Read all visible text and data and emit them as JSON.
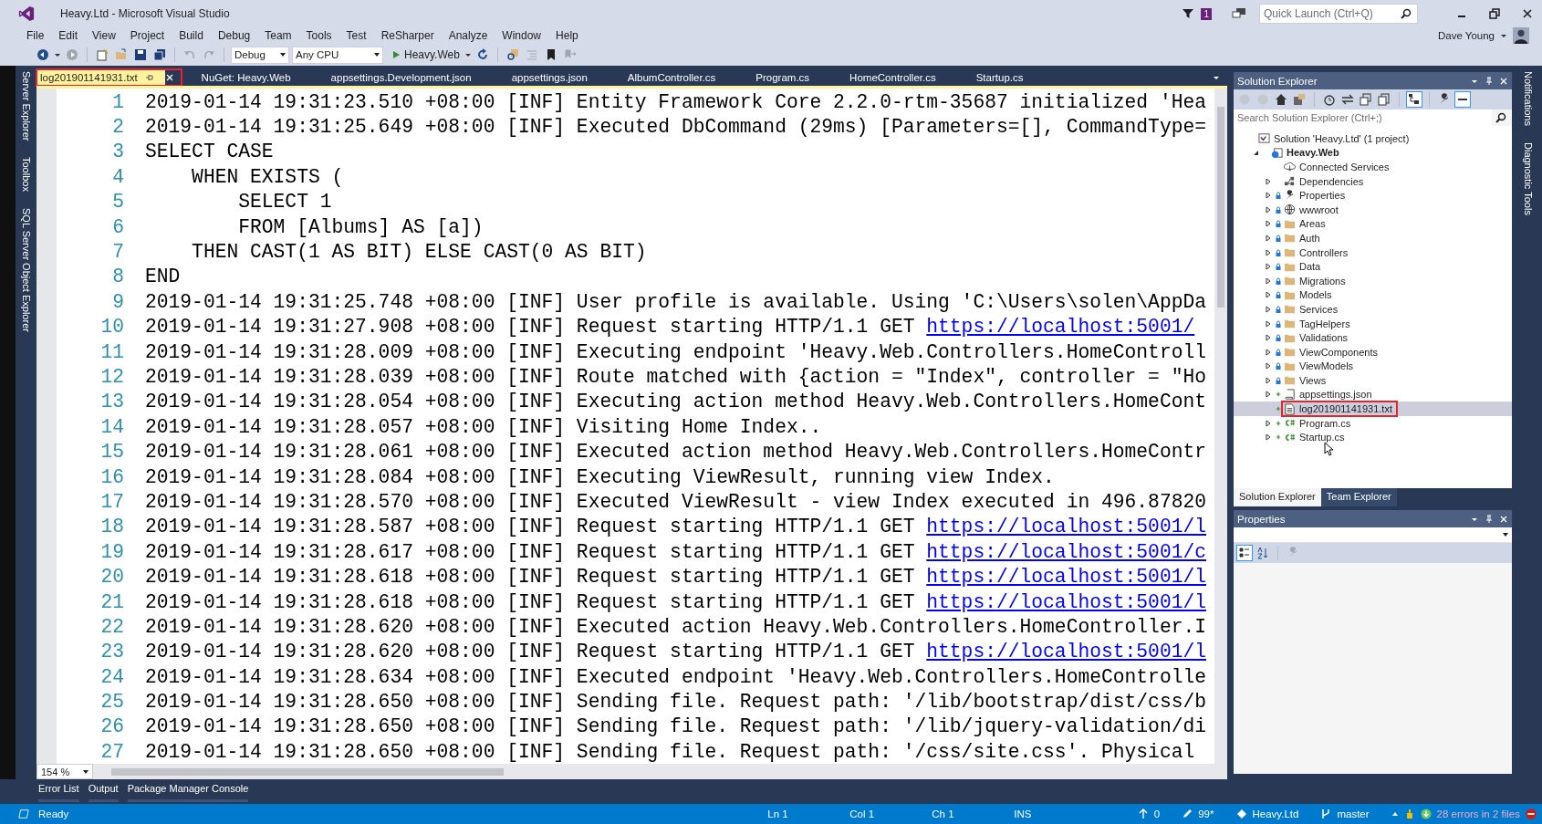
{
  "window": {
    "title": "Heavy.Ltd - Microsoft Visual Studio",
    "notification_count": "1",
    "quick_launch": {
      "placeholder": "Quick Launch (Ctrl+Q)"
    },
    "user": "Dave Young"
  },
  "menu": [
    "File",
    "Edit",
    "View",
    "Project",
    "Build",
    "Debug",
    "Team",
    "Tools",
    "Test",
    "ReSharper",
    "Analyze",
    "Window",
    "Help"
  ],
  "toolbar": {
    "configuration": "Debug",
    "platform": "Any CPU",
    "start_project": "Heavy.Web"
  },
  "left_tool_tabs": [
    "Server Explorer",
    "Toolbox",
    "SQL Server Object Explorer"
  ],
  "tabs": [
    {
      "label": "log201901141931.txt",
      "selected": true,
      "pinned": true,
      "marked": true
    },
    {
      "label": "NuGet: Heavy.Web",
      "selected": false,
      "pinned": false,
      "marked": false
    },
    {
      "label": "appsettings.Development.json",
      "selected": false,
      "pinned": false,
      "marked": false
    },
    {
      "label": "appsettings.json",
      "selected": false,
      "pinned": false,
      "marked": false
    },
    {
      "label": "AlbumController.cs",
      "selected": false,
      "pinned": false,
      "marked": false
    },
    {
      "label": "Program.cs",
      "selected": false,
      "pinned": false,
      "marked": false
    },
    {
      "label": "HomeController.cs",
      "selected": false,
      "pinned": false,
      "marked": false
    },
    {
      "label": "Startup.cs",
      "selected": false,
      "pinned": false,
      "marked": false
    }
  ],
  "editor": {
    "zoom": "154 %",
    "lines": [
      {
        "number": "1",
        "text": "2019-01-14 19:31:23.510 +08:00 [INF] Entity Framework Core 2.2.0-rtm-35687 initialized 'Hea"
      },
      {
        "number": "2",
        "text": "2019-01-14 19:31:25.649 +08:00 [INF] Executed DbCommand (29ms) [Parameters=[], CommandType="
      },
      {
        "number": "3",
        "text": "SELECT CASE"
      },
      {
        "number": "4",
        "text": "    WHEN EXISTS ("
      },
      {
        "number": "5",
        "text": "        SELECT 1"
      },
      {
        "number": "6",
        "text": "        FROM [Albums] AS [a])"
      },
      {
        "number": "7",
        "text": "    THEN CAST(1 AS BIT) ELSE CAST(0 AS BIT)"
      },
      {
        "number": "8",
        "text": "END"
      },
      {
        "number": "9",
        "text": "2019-01-14 19:31:25.748 +08:00 [INF] User profile is available. Using 'C:\\Users\\solen\\AppDa"
      },
      {
        "number": "10",
        "text": "2019-01-14 19:31:27.908 +08:00 [INF] Request starting HTTP/1.1 GET ",
        "link": "https://localhost:5001/"
      },
      {
        "number": "11",
        "text": "2019-01-14 19:31:28.009 +08:00 [INF] Executing endpoint 'Heavy.Web.Controllers.HomeControll"
      },
      {
        "number": "12",
        "text": "2019-01-14 19:31:28.039 +08:00 [INF] Route matched with {action = \"Index\", controller = \"Ho"
      },
      {
        "number": "13",
        "text": "2019-01-14 19:31:28.054 +08:00 [INF] Executing action method Heavy.Web.Controllers.HomeCont"
      },
      {
        "number": "14",
        "text": "2019-01-14 19:31:28.057 +08:00 [INF] Visiting Home Index.."
      },
      {
        "number": "15",
        "text": "2019-01-14 19:31:28.061 +08:00 [INF] Executed action method Heavy.Web.Controllers.HomeContr"
      },
      {
        "number": "16",
        "text": "2019-01-14 19:31:28.084 +08:00 [INF] Executing ViewResult, running view Index."
      },
      {
        "number": "17",
        "text": "2019-01-14 19:31:28.570 +08:00 [INF] Executed ViewResult - view Index executed in 496.87820"
      },
      {
        "number": "18",
        "text": "2019-01-14 19:31:28.587 +08:00 [INF] Request starting HTTP/1.1 GET ",
        "link": "https://localhost:5001/l"
      },
      {
        "number": "19",
        "text": "2019-01-14 19:31:28.617 +08:00 [INF] Request starting HTTP/1.1 GET ",
        "link": "https://localhost:5001/c"
      },
      {
        "number": "20",
        "text": "2019-01-14 19:31:28.618 +08:00 [INF] Request starting HTTP/1.1 GET ",
        "link": "https://localhost:5001/l"
      },
      {
        "number": "21",
        "text": "2019-01-14 19:31:28.618 +08:00 [INF] Request starting HTTP/1.1 GET ",
        "link": "https://localhost:5001/l"
      },
      {
        "number": "22",
        "text": "2019-01-14 19:31:28.620 +08:00 [INF] Executed action Heavy.Web.Controllers.HomeController.I"
      },
      {
        "number": "23",
        "text": "2019-01-14 19:31:28.620 +08:00 [INF] Request starting HTTP/1.1 GET ",
        "link": "https://localhost:5001/l"
      },
      {
        "number": "24",
        "text": "2019-01-14 19:31:28.634 +08:00 [INF] Executed endpoint 'Heavy.Web.Controllers.HomeControlle"
      },
      {
        "number": "25",
        "text": "2019-01-14 19:31:28.650 +08:00 [INF] Sending file. Request path: '/lib/bootstrap/dist/css/b"
      },
      {
        "number": "26",
        "text": "2019-01-14 19:31:28.650 +08:00 [INF] Sending file. Request path: '/lib/jquery-validation/di"
      },
      {
        "number": "27",
        "text": "2019-01-14 19:31:28.650 +08:00 [INF] Sending file. Request path: '/css/site.css'. Physical"
      }
    ]
  },
  "solution_explorer": {
    "title": "Solution Explorer",
    "search_placeholder": "Search Solution Explorer (Ctrl+;)",
    "tree": [
      {
        "label": "Solution 'Heavy.Ltd' (1 project)",
        "kind": "solution",
        "expandable": false,
        "locked": false,
        "added": false,
        "selected": false,
        "marked": false,
        "children": [
          {
            "label": "Heavy.Web",
            "kind": "project",
            "expandable": true,
            "expanded": true,
            "locked": false,
            "added": false,
            "selected": false,
            "marked": false,
            "children": [
              {
                "label": "Connected Services",
                "kind": "connected",
                "expandable": false,
                "locked": false,
                "added": false,
                "selected": false,
                "marked": false
              },
              {
                "label": "Dependencies",
                "kind": "dependencies",
                "expandable": true,
                "expanded": false,
                "locked": false,
                "added": false,
                "selected": false,
                "marked": false
              },
              {
                "label": "Properties",
                "kind": "properties",
                "expandable": true,
                "expanded": false,
                "locked": true,
                "added": false,
                "selected": false,
                "marked": false
              },
              {
                "label": "wwwroot",
                "kind": "webroot",
                "expandable": true,
                "expanded": false,
                "locked": true,
                "added": false,
                "selected": false,
                "marked": false
              },
              {
                "label": "Areas",
                "kind": "folder",
                "expandable": true,
                "expanded": false,
                "locked": true,
                "added": false,
                "selected": false,
                "marked": false
              },
              {
                "label": "Auth",
                "kind": "folder",
                "expandable": true,
                "expanded": false,
                "locked": true,
                "added": false,
                "selected": false,
                "marked": false
              },
              {
                "label": "Controllers",
                "kind": "folder",
                "expandable": true,
                "expanded": false,
                "locked": true,
                "added": false,
                "selected": false,
                "marked": false
              },
              {
                "label": "Data",
                "kind": "folder",
                "expandable": true,
                "expanded": false,
                "locked": true,
                "added": false,
                "selected": false,
                "marked": false
              },
              {
                "label": "Migrations",
                "kind": "folder",
                "expandable": true,
                "expanded": false,
                "locked": true,
                "added": false,
                "selected": false,
                "marked": false
              },
              {
                "label": "Models",
                "kind": "folder",
                "expandable": true,
                "expanded": false,
                "locked": true,
                "added": false,
                "selected": false,
                "marked": false
              },
              {
                "label": "Services",
                "kind": "folder",
                "expandable": true,
                "expanded": false,
                "locked": true,
                "added": false,
                "selected": false,
                "marked": false
              },
              {
                "label": "TagHelpers",
                "kind": "folder",
                "expandable": true,
                "expanded": false,
                "locked": true,
                "added": false,
                "selected": false,
                "marked": false
              },
              {
                "label": "Validations",
                "kind": "folder",
                "expandable": true,
                "expanded": false,
                "locked": true,
                "added": false,
                "selected": false,
                "marked": false
              },
              {
                "label": "ViewComponents",
                "kind": "folder",
                "expandable": true,
                "expanded": false,
                "locked": true,
                "added": false,
                "selected": false,
                "marked": false
              },
              {
                "label": "ViewModels",
                "kind": "folder",
                "expandable": true,
                "expanded": false,
                "locked": true,
                "added": false,
                "selected": false,
                "marked": false
              },
              {
                "label": "Views",
                "kind": "folder",
                "expandable": true,
                "expanded": false,
                "locked": true,
                "added": false,
                "selected": false,
                "marked": false
              },
              {
                "label": "appsettings.json",
                "kind": "json",
                "expandable": true,
                "expanded": false,
                "locked": false,
                "added": true,
                "selected": false,
                "marked": false
              },
              {
                "label": "log201901141931.txt",
                "kind": "text",
                "expandable": false,
                "locked": false,
                "added": true,
                "selected": true,
                "marked": true
              },
              {
                "label": "Program.cs",
                "kind": "csharp",
                "expandable": true,
                "expanded": false,
                "locked": false,
                "added": true,
                "selected": false,
                "marked": false
              },
              {
                "label": "Startup.cs",
                "kind": "csharp",
                "expandable": true,
                "expanded": false,
                "locked": false,
                "added": true,
                "selected": false,
                "marked": false
              }
            ]
          }
        ]
      }
    ],
    "panel_tabs": [
      {
        "label": "Solution Explorer",
        "selected": true
      },
      {
        "label": "Team Explorer",
        "selected": false
      }
    ]
  },
  "properties": {
    "title": "Properties"
  },
  "right_tool_tabs": [
    "Notifications",
    "Diagnostic Tools"
  ],
  "bottom_tabs": [
    "Error List",
    "Output",
    "Package Manager Console"
  ],
  "status_bar": {
    "state": "Ready",
    "line": "Ln 1",
    "column": "Col 1",
    "char": "Ch 1",
    "mode": "INS",
    "pushes": "0",
    "changes": "99*",
    "repository": "Heavy.Ltd",
    "branch": "master",
    "errors": "28 errors in 2 files"
  }
}
